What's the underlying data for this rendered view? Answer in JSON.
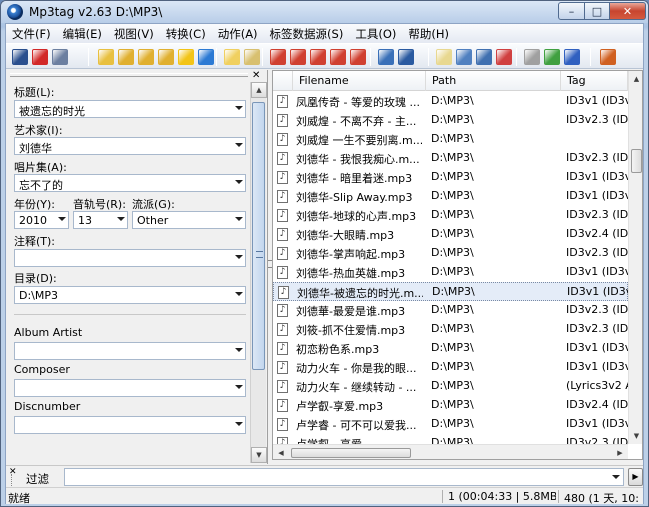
{
  "window": {
    "title": "Mp3tag v2.63   D:\\MP3\\",
    "min_glyph": "–",
    "max_glyph": "□",
    "close_glyph": "✕"
  },
  "menu": [
    "文件(F)",
    "编辑(E)",
    "视图(V)",
    "转换(C)",
    "动作(A)",
    "标签数据源(S)",
    "工具(O)",
    "帮助(H)"
  ],
  "toolbar_icons": [
    {
      "name": "save-icon",
      "color": "#2a4f8e"
    },
    {
      "name": "remove-tag-icon",
      "color": "#d22828"
    },
    {
      "name": "undo-icon",
      "color": "#6c7fa0"
    },
    {
      "name": "open-folder-icon",
      "color": "#e8c040"
    },
    {
      "name": "add-folder-icon",
      "color": "#e0b030"
    },
    {
      "name": "change-directory-icon",
      "color": "#e0b030"
    },
    {
      "name": "playlist-icon",
      "color": "#e0b030"
    },
    {
      "name": "favorites-icon",
      "color": "#f2c418"
    },
    {
      "name": "refresh-icon",
      "color": "#2c7ad4"
    },
    {
      "name": "copy-tag-icon",
      "color": "#f0d060"
    },
    {
      "name": "paste-tag-icon",
      "color": "#d8c070"
    },
    {
      "name": "filename-tag-icon",
      "color": "#d04030"
    },
    {
      "name": "tag-filename-icon",
      "color": "#d04030"
    },
    {
      "name": "text-tag-icon",
      "color": "#d04030"
    },
    {
      "name": "tag-tag-icon",
      "color": "#d04030"
    },
    {
      "name": "export-icon",
      "color": "#d04030"
    },
    {
      "name": "actions-icon",
      "color": "#3a70b8"
    },
    {
      "name": "case-conversion-icon",
      "color": "#2a5aa0"
    },
    {
      "name": "edit-icon",
      "color": "#e8d890"
    },
    {
      "name": "extended-tags-icon",
      "color": "#5080c0"
    },
    {
      "name": "autonumber-icon",
      "color": "#4070b0"
    },
    {
      "name": "numbering-icon",
      "color": "#d04040"
    },
    {
      "name": "freedb-icon",
      "color": "#a0a0a0"
    },
    {
      "name": "web-source-icon",
      "color": "#40a040"
    },
    {
      "name": "amazon-icon",
      "color": "#3060c0"
    },
    {
      "name": "options-icon",
      "color": "#d06020"
    }
  ],
  "tag_panel": {
    "close_glyph": "✕",
    "title_label": "标题(L):",
    "title_value": "被遗忘的时光",
    "artist_label": "艺术家(I):",
    "artist_value": "刘德华",
    "album_label": "唱片集(A):",
    "album_value": "忘不了的",
    "year_label": "年份(Y):",
    "year_value": "2010",
    "track_label": "音轨号(R):",
    "track_value": "13",
    "genre_label": "流派(G):",
    "genre_value": "Other",
    "comment_label": "注释(T):",
    "comment_value": "",
    "directory_label": "目录(D):",
    "directory_value": "D:\\MP3",
    "album_artist_label": "Album Artist",
    "album_artist_value": "",
    "composer_label": "Composer",
    "composer_value": "",
    "discnumber_label": "Discnumber",
    "discnumber_value": ""
  },
  "file_list": {
    "columns": [
      "Filename",
      "Path",
      "Tag"
    ],
    "rows": [
      {
        "filename": "凤凰传奇 - 等爱的玫瑰 ...",
        "path": "D:\\MP3\\",
        "tag": "ID3v1 (ID3v"
      },
      {
        "filename": "刘威煌 - 不离不弃 - 主...",
        "path": "D:\\MP3\\",
        "tag": "ID3v2.3 (ID3"
      },
      {
        "filename": "刘威煌 一生不要别离.m...",
        "path": "D:\\MP3\\",
        "tag": ""
      },
      {
        "filename": "刘德华 - 我恨我痴心.m...",
        "path": "D:\\MP3\\",
        "tag": "ID3v2.3 (ID3v"
      },
      {
        "filename": "刘德华 - 暗里着迷.mp3",
        "path": "D:\\MP3\\",
        "tag": "ID3v1 (ID3v1"
      },
      {
        "filename": "刘德华-Slip Away.mp3",
        "path": "D:\\MP3\\",
        "tag": "ID3v1 (ID3v1"
      },
      {
        "filename": "刘德华-地球的心声.mp3",
        "path": "D:\\MP3\\",
        "tag": "ID3v2.3 (ID3"
      },
      {
        "filename": "刘德华-大眼睛.mp3",
        "path": "D:\\MP3\\",
        "tag": "ID3v2.4 (ID3"
      },
      {
        "filename": "刘德华-掌声响起.mp3",
        "path": "D:\\MP3\\",
        "tag": "ID3v2.3 (ID3"
      },
      {
        "filename": "刘德华-热血英雄.mp3",
        "path": "D:\\MP3\\",
        "tag": "ID3v1 (ID3v1"
      },
      {
        "filename": "刘德华-被遗忘的时光.m...",
        "path": "D:\\MP3\\",
        "tag": "ID3v1 (ID3v1"
      },
      {
        "filename": "刘德華-最爱是谁.mp3",
        "path": "D:\\MP3\\",
        "tag": "ID3v2.3 (ID3"
      },
      {
        "filename": "刘筱-抓不住爱情.mp3",
        "path": "D:\\MP3\\",
        "tag": "ID3v2.3 (ID3"
      },
      {
        "filename": "初恋粉色系.mp3",
        "path": "D:\\MP3\\",
        "tag": "ID3v1 (ID3v1"
      },
      {
        "filename": "动力火车 - 你是我的眼...",
        "path": "D:\\MP3\\",
        "tag": "ID3v1 (ID3v1)"
      },
      {
        "filename": "动力火车 - 继续转动 - ...",
        "path": "D:\\MP3\\",
        "tag": "(Lyrics3v2 AP"
      },
      {
        "filename": "卢学叡-享爱.mp3",
        "path": "D:\\MP3\\",
        "tag": "ID3v2.4 (ID3v"
      },
      {
        "filename": "卢学睿 - 可不可以爱我...",
        "path": "D:\\MP3\\",
        "tag": "ID3v1 (ID3v1"
      },
      {
        "filename": "卢学叡 - 享爱...",
        "path": "D:\\MP3\\",
        "tag": "ID3v2.3 (ID3"
      }
    ],
    "selected_index": 10
  },
  "filter": {
    "label": "过滤",
    "value": "",
    "close_glyph": "✕",
    "go_glyph": "▶"
  },
  "status": {
    "ready": "就绪",
    "selection": "1 (00:04:33 | 5.8MB)",
    "total": "480 (1 天, 10:"
  }
}
